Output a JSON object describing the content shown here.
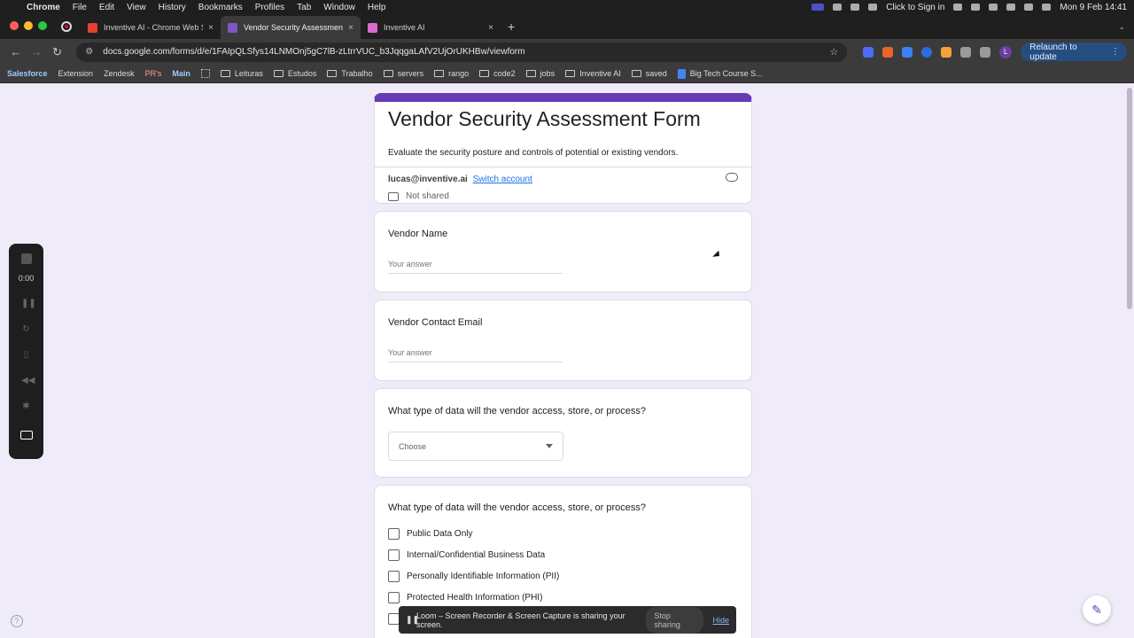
{
  "menubar": {
    "app": "Chrome",
    "items": [
      "File",
      "Edit",
      "View",
      "History",
      "Bookmarks",
      "Profiles",
      "Tab",
      "Window",
      "Help"
    ],
    "click_to_sign_in": "Click to Sign in",
    "datetime": "Mon 9 Feb  14:41"
  },
  "tabs": [
    {
      "title": "Inventive AI - Chrome Web St",
      "favicon_color": "#e34133",
      "active": false
    },
    {
      "title": "Vendor Security Assessment",
      "favicon_color": "#7e57c2",
      "active": true
    },
    {
      "title": "Inventive AI",
      "favicon_color": "#d86cce",
      "active": false
    }
  ],
  "toolbar": {
    "url": "docs.google.com/forms/d/e/1FAIpQLSfys14LNMOnj5gC7lB-zLtrrVUC_b3JqqgaLAfV2UjOrUKHBw/viewform",
    "relaunch_label": "Relaunch to update",
    "profile_initial": "L"
  },
  "bookmarks": [
    {
      "label": "Salesforce",
      "style": "colored"
    },
    {
      "label": "Extension",
      "style": "plain"
    },
    {
      "label": "Zendesk",
      "style": "plain"
    },
    {
      "label": "PR's",
      "style": "red"
    },
    {
      "label": "Main",
      "style": "colored"
    },
    {
      "label": "Leituras",
      "style": "folder"
    },
    {
      "label": "Estudos",
      "style": "folder"
    },
    {
      "label": "Trabalho",
      "style": "folder"
    },
    {
      "label": "servers",
      "style": "folder"
    },
    {
      "label": "rango",
      "style": "folder"
    },
    {
      "label": "code2",
      "style": "folder"
    },
    {
      "label": "jobs",
      "style": "folder"
    },
    {
      "label": "Inventive AI",
      "style": "folder"
    },
    {
      "label": "saved",
      "style": "folder"
    },
    {
      "label": "Big Tech Course S...",
      "style": "doc"
    }
  ],
  "form": {
    "title": "Vendor Security Assessment Form",
    "description": "Evaluate the security posture and controls of potential or existing vendors.",
    "account_email": "lucas@inventive.ai",
    "switch_account": "Switch account",
    "not_shared": "Not shared",
    "accent_color": "#673ab7",
    "questions": [
      {
        "title": "Vendor Name",
        "placeholder": "Your answer"
      },
      {
        "title": "Vendor Contact Email",
        "placeholder": "Your answer"
      },
      {
        "title": "What type of data will the vendor access, store, or process?",
        "select_value": "Choose"
      },
      {
        "title": "What type of data will the vendor access, store, or process?",
        "options": [
          "Public Data Only",
          "Internal/Confidential Business Data",
          "Personally Identifiable Information (PII)",
          "Protected Health Information (PHI)"
        ]
      }
    ]
  },
  "loom": {
    "timer": "0:00",
    "banner_text": "Loom – Screen Recorder & Screen Capture is sharing your screen.",
    "stop_sharing": "Stop sharing",
    "hide": "Hide"
  }
}
